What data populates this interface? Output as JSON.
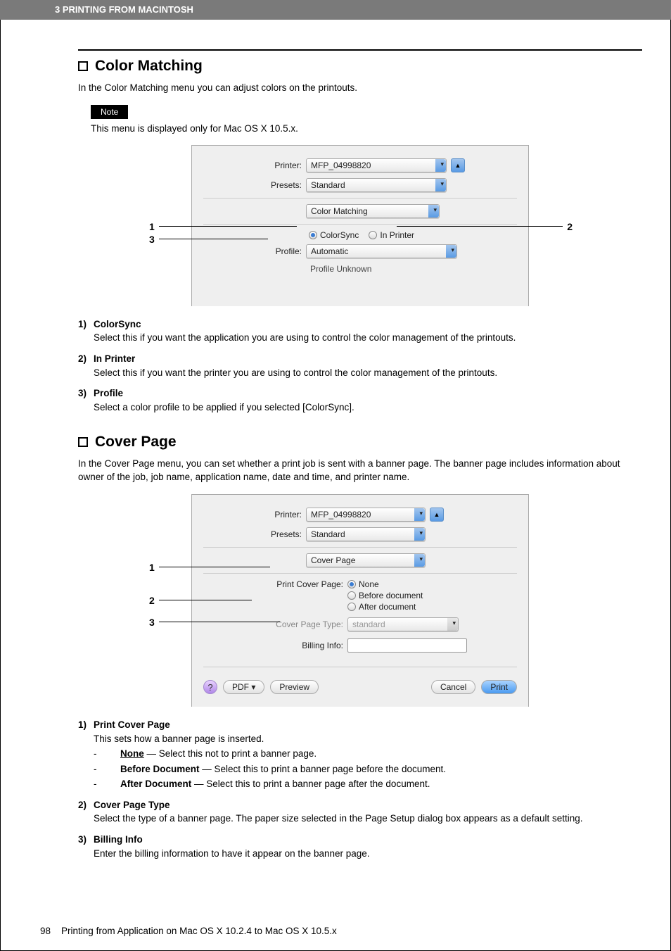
{
  "header": {
    "breadcrumb": "3 PRINTING FROM MACINTOSH"
  },
  "section1": {
    "title": "Color Matching",
    "intro": "In the Color Matching menu you can adjust colors on the printouts.",
    "note_tag": "Note",
    "note_text": "This menu is displayed only for Mac OS X 10.5.x.",
    "dialog": {
      "printer_label": "Printer:",
      "printer_value": "MFP_04998820",
      "presets_label": "Presets:",
      "presets_value": "Standard",
      "panel_value": "Color Matching",
      "radio1": "ColorSync",
      "radio2": "In Printer",
      "profile_label": "Profile:",
      "profile_value": "Automatic",
      "profile_sub": "Profile Unknown"
    },
    "callouts": {
      "l1": "1",
      "l3": "3",
      "r2": "2"
    },
    "defs": [
      {
        "num": "1)",
        "term": "ColorSync",
        "body": "Select this if you want the application you are using to control the color management of the printouts."
      },
      {
        "num": "2)",
        "term": "In Printer",
        "body": "Select this if you want the printer you are using to control the color management of the printouts."
      },
      {
        "num": "3)",
        "term": "Profile",
        "body": "Select a color profile to be applied if you selected [ColorSync]."
      }
    ]
  },
  "section2": {
    "title": "Cover Page",
    "intro": "In the Cover Page menu, you can set whether a print job is sent with a banner page.  The banner page includes information about owner of the job, job name, application name, date and time, and printer name.",
    "dialog": {
      "printer_label": "Printer:",
      "printer_value": "MFP_04998820",
      "presets_label": "Presets:",
      "presets_value": "Standard",
      "panel_value": "Cover Page",
      "pcp_label": "Print Cover Page:",
      "opt_none": "None",
      "opt_before": "Before document",
      "opt_after": "After document",
      "cpt_label": "Cover Page Type:",
      "cpt_value": "standard",
      "billing_label": "Billing Info:",
      "help": "?",
      "pdf": "PDF ▾",
      "preview": "Preview",
      "cancel": "Cancel",
      "print": "Print"
    },
    "callouts": {
      "l1": "1",
      "l2": "2",
      "l3": "3"
    },
    "defs": [
      {
        "num": "1)",
        "term": "Print Cover Page",
        "body": "This sets how a banner page is inserted.",
        "opts": [
          {
            "name": "None",
            "desc": " — Select this not to print a banner page.",
            "selected": true
          },
          {
            "name": "Before Document",
            "desc": " — Select this to print a banner page before the document."
          },
          {
            "name": "After Document",
            "desc": " — Select this to print a banner page after the document."
          }
        ]
      },
      {
        "num": "2)",
        "term": "Cover Page Type",
        "body": "Select the type of a banner page.  The paper size selected in the Page Setup dialog box appears as a default setting."
      },
      {
        "num": "3)",
        "term": "Billing Info",
        "body": "Enter the billing information to have it appear on the banner page."
      }
    ]
  },
  "footer": {
    "page": "98",
    "text": "Printing from Application on Mac OS X 10.2.4 to Mac OS X 10.5.x"
  }
}
